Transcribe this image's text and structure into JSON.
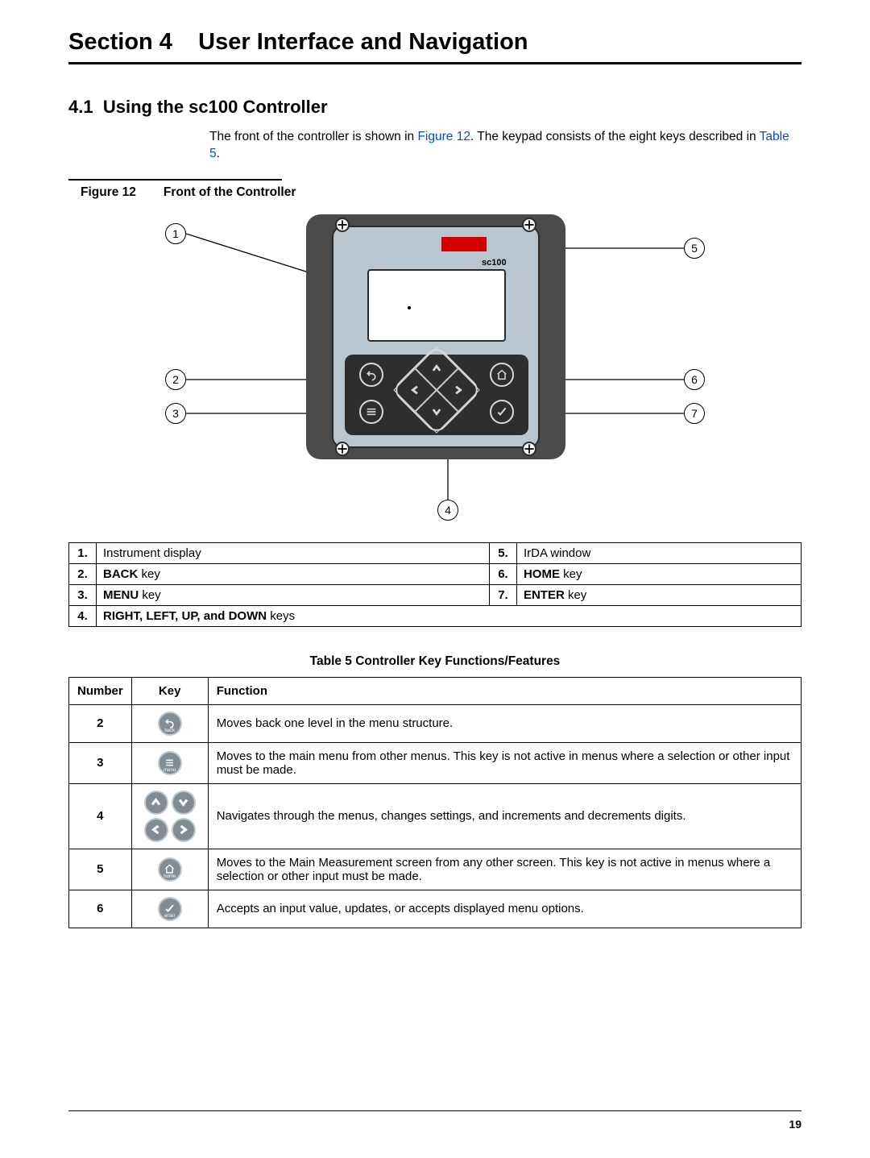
{
  "section": {
    "label": "Section 4",
    "title": "User Interface and Navigation"
  },
  "subsection": {
    "num": "4.1",
    "title": "Using the sc100 Controller"
  },
  "intro": {
    "t1": "The front of the controller is shown in ",
    "figref": "Figure 12",
    "t2": ". The keypad consists of the eight keys described in ",
    "tabref": "Table 5",
    "t3": "."
  },
  "figure": {
    "num": "Figure 12",
    "title": "Front of the Controller",
    "brand": "sc100"
  },
  "legend": [
    {
      "n": "1.",
      "label": "Instrument display",
      "bold": ""
    },
    {
      "n": "2.",
      "label": " key",
      "bold": "BACK"
    },
    {
      "n": "3.",
      "label": " key",
      "bold": "MENU"
    },
    {
      "n": "4.",
      "label": " keys",
      "bold": "RIGHT, LEFT, UP, and DOWN"
    },
    {
      "n": "5.",
      "label": "IrDA window",
      "bold": ""
    },
    {
      "n": "6.",
      "label": " key",
      "bold": "HOME"
    },
    {
      "n": "7.",
      "label": " key",
      "bold": "ENTER"
    }
  ],
  "table5": {
    "caption": "Table 5 Controller Key Functions/Features",
    "headers": {
      "n": "Number",
      "k": "Key",
      "f": "Function"
    },
    "rows": [
      {
        "n": "2",
        "icon": "back",
        "f": "Moves back one level in the menu structure."
      },
      {
        "n": "3",
        "icon": "menu",
        "f": "Moves to the main menu from other menus. This key is not active in menus where a selection or other input must be made."
      },
      {
        "n": "4",
        "icon": "arrows",
        "f": "Navigates through the menus, changes settings, and increments and decrements digits."
      },
      {
        "n": "5",
        "icon": "home",
        "f": "Moves to the Main Measurement screen from any other screen. This key is not active in menus where a selection or other input must be made."
      },
      {
        "n": "6",
        "icon": "enter",
        "f": "Accepts an input value, updates, or accepts displayed menu options."
      }
    ]
  },
  "callouts": [
    "1",
    "2",
    "3",
    "4",
    "5",
    "6",
    "7"
  ],
  "page_number": "19"
}
